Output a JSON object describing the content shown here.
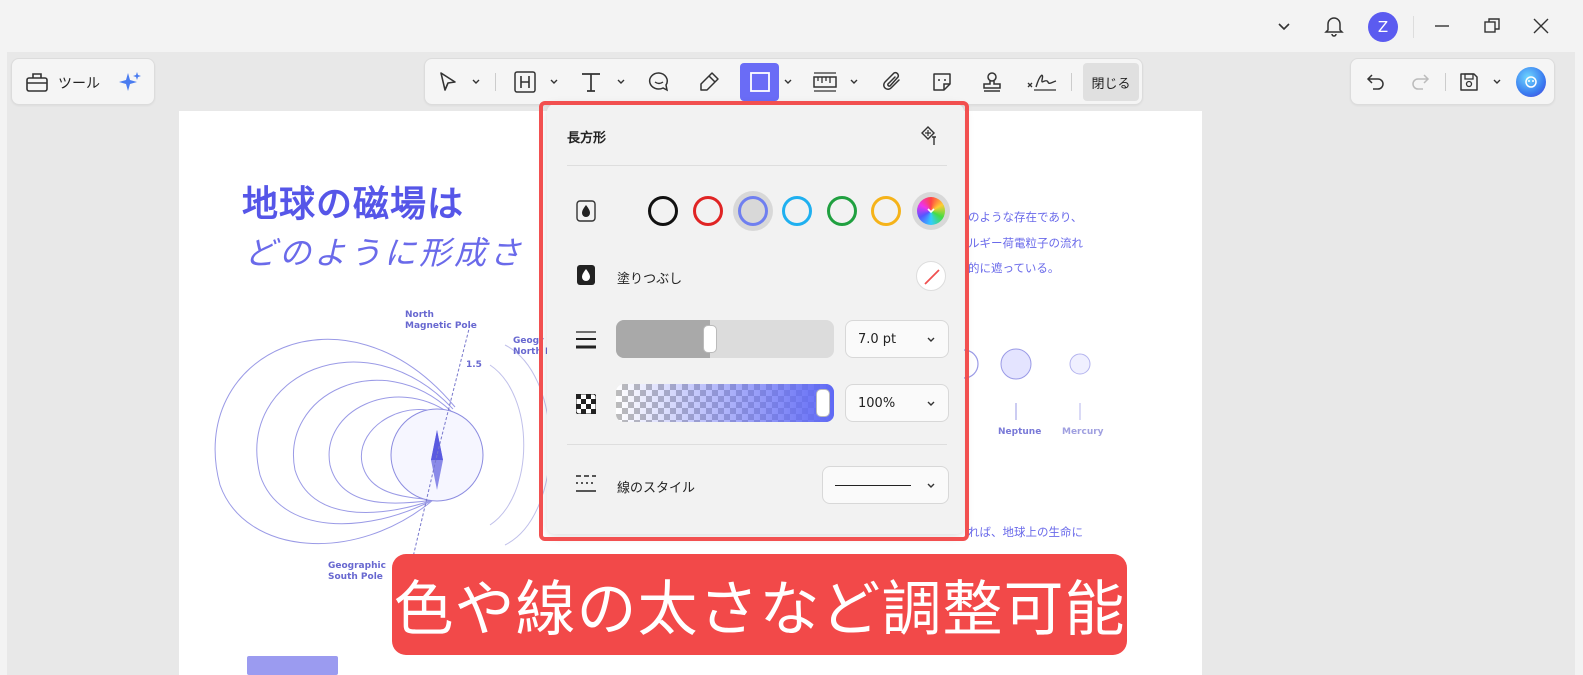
{
  "titlebar": {
    "avatar_letter": "Z"
  },
  "left_group": {
    "tools_label": "ツール"
  },
  "toolbar": {
    "close_label": "閉じる"
  },
  "document": {
    "title_line1": "地球の磁場は",
    "title_line2": "どのように形成さ",
    "para1": [
      "のような存在であり、",
      "ルギー荷電粒子の流れ",
      "的に遮っている。"
    ],
    "para2": [
      "れば、地球上の生命に"
    ],
    "labels": {
      "north_magnetic": [
        "North",
        "Magnetic Pole"
      ],
      "geo_north": [
        "Geogr",
        "North P"
      ],
      "geo_south": [
        "Geographic",
        "South Pole"
      ],
      "angle": "1.5"
    },
    "planets": [
      "Neptune",
      "Mercury"
    ]
  },
  "panel": {
    "title": "長方形",
    "fill_label": "塗りつぶし",
    "line_style_label": "線のスタイル",
    "thickness_value": "7.0 pt",
    "thickness_fraction": 0.43,
    "opacity_value": "100%",
    "opacity_fraction": 1.0,
    "colors": [
      "#111111",
      "#e02424",
      "#6f7ff0",
      "#1fb0f0",
      "#20a040",
      "#f5b31a",
      "spectrum"
    ],
    "selected_color": "#6f7ff0"
  },
  "banner": {
    "text": "色や線の太さなど調整可能"
  }
}
